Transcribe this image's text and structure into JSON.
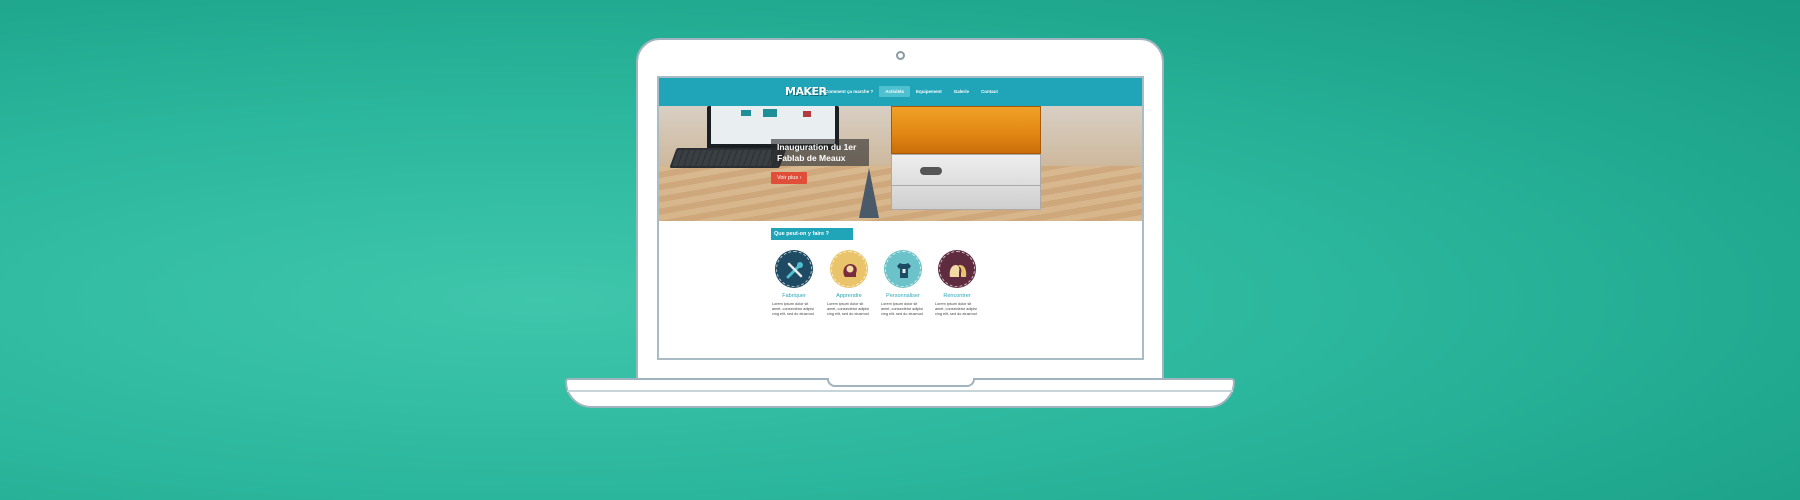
{
  "site": {
    "logo": "MAKER",
    "nav": [
      {
        "label": "Comment ça marche ?",
        "active": false
      },
      {
        "label": "Activités",
        "active": true
      },
      {
        "label": "Equipement",
        "active": false
      },
      {
        "label": "Galerie",
        "active": false
      },
      {
        "label": "Contact",
        "active": false
      }
    ],
    "hero": {
      "title_line1": "Inauguration du 1er",
      "title_line2": "Fablab de Meaux",
      "button": "Voir plus  ›"
    },
    "section_title": "Que peut-on y faire ?",
    "features": [
      {
        "label": "Fabriquer",
        "text": "Lorem ipsum dolor sit\namet, consectetur adipisi\ncing elit, sed do eiusmod",
        "icon": "tools-icon",
        "color": "#1e4a63"
      },
      {
        "label": "Apprendre",
        "text": "Lorem ipsum dolor sit\namet, consectetur adipisi\ncing elit, sed do eiusmod",
        "icon": "head-brain-icon",
        "color": "#e9c46a"
      },
      {
        "label": "Personnaliser",
        "text": "Lorem ipsum dolor sit\namet, consectetur adipisi\ncing elit, sed do eiusmod",
        "icon": "tshirt-icon",
        "color": "#6cc2c9"
      },
      {
        "label": "Rencontrer",
        "text": "Lorem ipsum dolor sit\namet, consectetur adipisi\ncing elit, sed do eiusmod",
        "icon": "people-icon",
        "color": "#5e2b3f"
      }
    ]
  },
  "colors": {
    "background": "#2bb79d",
    "nav": "#1fa4b8",
    "button": "#e04e3a"
  }
}
